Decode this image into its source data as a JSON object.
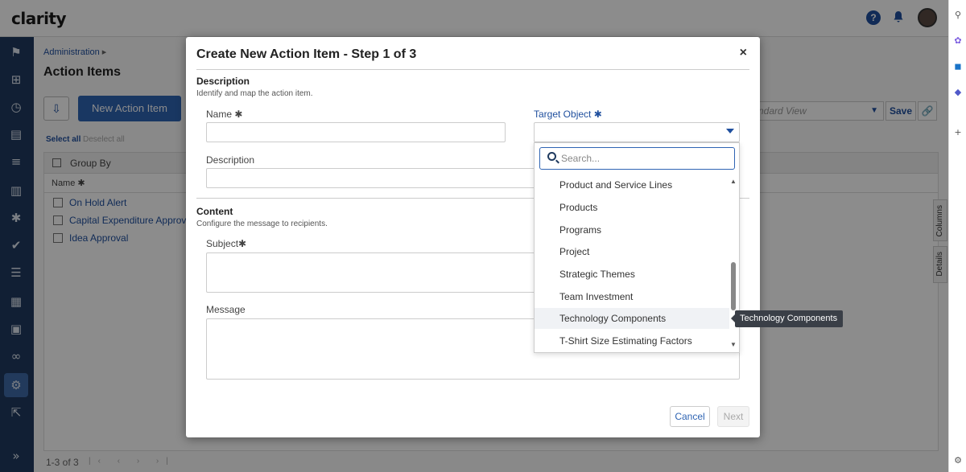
{
  "app": {
    "logo": "clarity"
  },
  "header": {
    "help": "?",
    "bell": "🔔"
  },
  "breadcrumb": {
    "text": "Administration",
    "sep": "▸"
  },
  "page": {
    "title": "Action Items",
    "new_button": "New Action Item",
    "view_placeholder": "ndard View",
    "save": "Save",
    "select_all": "Select all",
    "deselect_all": "Deselect all",
    "group_by": "Group By",
    "col_name": "Name ✱",
    "rows": [
      "On Hold Alert",
      "Capital Expenditure Approva",
      "Idea Approval"
    ],
    "pager": "1-3 of 3",
    "pager_arrows": "|‹ ‹ › ›|",
    "side_tabs": [
      "Columns",
      "Details"
    ]
  },
  "dialog": {
    "title": "Create New Action Item - Step 1 of 3",
    "close": "×",
    "description_section": {
      "heading": "Description",
      "sub": "Identify and map the action item."
    },
    "name_label": "Name ✱",
    "target_label": "Target Object ✱",
    "description_label": "Description",
    "content_section": {
      "heading": "Content",
      "sub": "Configure the message to recipients."
    },
    "subject_label": "Subject✱",
    "message_label": "Message",
    "cancel": "Cancel",
    "next": "Next"
  },
  "dropdown": {
    "search_placeholder": "Search...",
    "items": [
      "Product and Service Lines",
      "Products",
      "Programs",
      "Project",
      "Strategic Themes",
      "Team Investment",
      "Technology Components",
      "T-Shirt Size Estimating Factors"
    ],
    "hovered_index": 6,
    "tooltip": "Technology Components"
  },
  "colors": {
    "primary": "#2f64b3",
    "nav": "#1f3a5f",
    "link": "#1f4f9e"
  }
}
